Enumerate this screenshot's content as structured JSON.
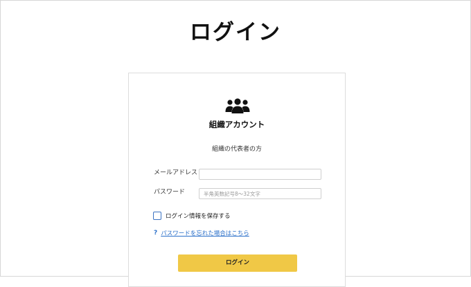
{
  "page": {
    "title": "ログイン"
  },
  "card": {
    "icon": "group-users-icon",
    "account_type": "組織アカウント",
    "description": "組織の代表者の方"
  },
  "form": {
    "email_label": "メールアドレス",
    "email_value": "",
    "password_label": "パスワード",
    "password_placeholder": "半角英数記号8〜32文字",
    "remember_label": "ログイン情報を保存する",
    "remember_checked": false,
    "help_icon": "question-icon",
    "forgot_link": "パスワードを忘れた場合はこちら",
    "submit_label": "ログイン"
  },
  "colors": {
    "button": "#f0c846",
    "link": "#2a6fc9",
    "checkbox_border": "#3a72c2"
  }
}
